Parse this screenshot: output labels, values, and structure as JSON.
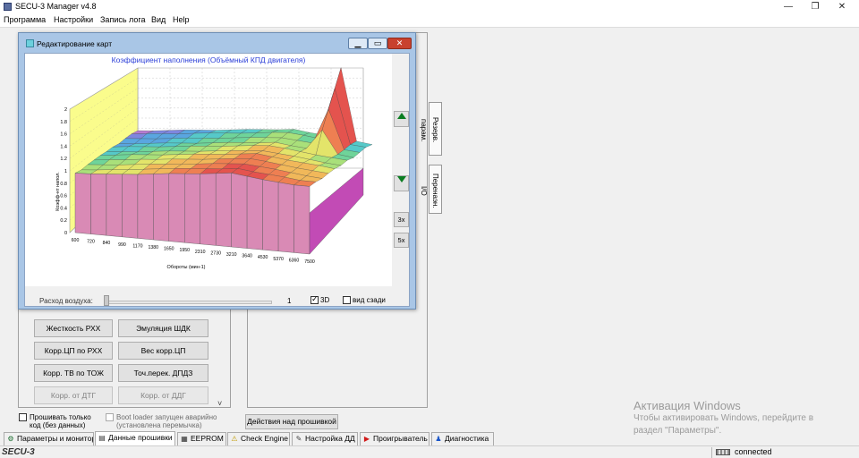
{
  "app": {
    "title": "SECU-3 Manager v4.8"
  },
  "window_controls": {
    "minimize": "—",
    "restore": "❐",
    "close": "✕"
  },
  "menu": [
    "Программа",
    "Настройки",
    "Запись лога",
    "Вид",
    "Help"
  ],
  "dialog": {
    "title": "Редактирование карт",
    "controls": {
      "minimize": "▁",
      "maximize": "▭",
      "close": "✕"
    },
    "side_buttons": {
      "zoom3": "3x",
      "zoom5": "5x"
    },
    "slider": {
      "label": "Расход воздуха:",
      "value": "1",
      "position": 0
    },
    "checkbox_3d": {
      "label": "3D",
      "checked": true
    },
    "checkbox_back": {
      "label": "вид сзади",
      "checked": false
    }
  },
  "chart_data": {
    "type": "surface3d",
    "title": "Коэффициент наполнения (Объёмный КПД двигателя)",
    "xlabel": "Обороты (мин-1)",
    "ylabel": "Коэфф-нт напол.",
    "zlim": [
      0,
      2
    ],
    "z_ticks": [
      "0",
      "0.2",
      "0.4",
      "0.6",
      "0.8",
      "1",
      "1.2",
      "1.4",
      "1.6",
      "1.8",
      "2"
    ],
    "x": [
      "600",
      "720",
      "840",
      "990",
      "1170",
      "1380",
      "1650",
      "1950",
      "2310",
      "2730",
      "3210",
      "3640",
      "4530",
      "5370",
      "6360",
      "7500"
    ],
    "rows_z": [
      [
        0.95,
        0.96,
        0.98,
        1.0,
        1.02,
        1.05,
        1.08,
        1.1,
        1.12,
        1.15,
        1.18,
        1.15,
        1.12,
        1.1,
        1.08,
        1.08
      ],
      [
        0.9,
        0.92,
        0.95,
        0.97,
        1.0,
        1.03,
        1.06,
        1.08,
        1.1,
        1.12,
        1.15,
        1.12,
        1.1,
        1.08,
        1.05,
        1.05
      ],
      [
        0.88,
        0.9,
        0.92,
        0.95,
        0.98,
        1.0,
        1.02,
        1.05,
        1.08,
        1.1,
        1.12,
        1.1,
        1.08,
        1.05,
        1.02,
        1.0
      ],
      [
        0.85,
        0.88,
        0.9,
        0.93,
        0.95,
        0.98,
        1.0,
        1.02,
        1.05,
        1.08,
        1.1,
        1.08,
        1.05,
        1.02,
        1.0,
        0.98
      ],
      [
        0.82,
        0.85,
        0.88,
        0.9,
        0.92,
        0.95,
        0.98,
        1.0,
        1.02,
        1.05,
        1.08,
        1.05,
        1.02,
        1.0,
        0.98,
        0.95
      ],
      [
        0.78,
        0.8,
        0.82,
        0.85,
        0.88,
        0.9,
        0.92,
        0.95,
        0.98,
        1.0,
        1.02,
        1.0,
        0.98,
        0.95,
        0.92,
        0.9
      ],
      [
        0.75,
        0.78,
        0.8,
        0.82,
        0.85,
        0.88,
        0.9,
        0.92,
        0.95,
        0.98,
        1.0,
        0.98,
        0.95,
        0.92,
        0.9,
        0.88
      ],
      [
        0.7,
        0.72,
        0.75,
        0.78,
        0.8,
        0.82,
        0.85,
        0.88,
        0.9,
        0.92,
        0.95,
        0.92,
        0.9,
        0.88,
        0.85,
        0.82
      ],
      [
        0.68,
        0.7,
        0.72,
        0.75,
        0.78,
        0.8,
        0.82,
        0.85,
        0.88,
        0.9,
        0.92,
        0.9,
        0.88,
        0.85,
        0.82,
        0.8
      ],
      [
        0.65,
        0.68,
        0.7,
        0.72,
        0.75,
        0.78,
        0.8,
        0.82,
        0.85,
        0.88,
        0.9,
        0.88,
        0.85,
        0.82,
        0.8,
        0.78
      ],
      [
        0.6,
        0.62,
        0.65,
        0.68,
        0.7,
        0.72,
        0.75,
        0.78,
        0.8,
        0.82,
        0.85,
        0.82,
        0.8,
        0.78,
        0.75,
        0.72
      ]
    ],
    "peak": {
      "x": "5370",
      "z": 1.9
    }
  },
  "vertical_tabs": [
    "Резерв. парам.",
    "Перенаэн. I/O"
  ],
  "left_buttons": [
    {
      "label": "Жесткость РХХ",
      "disabled": false
    },
    {
      "label": "Эмуляция ШДК",
      "disabled": false
    },
    {
      "label": "Корр.ЦП по РХХ",
      "disabled": false
    },
    {
      "label": "Вес корр.ЦП",
      "disabled": false
    },
    {
      "label": "Корр. ТВ по ТОЖ",
      "disabled": false
    },
    {
      "label": "Точ.перек. ДПДЗ",
      "disabled": false
    },
    {
      "label": "Корр. от ДТГ",
      "disabled": true
    },
    {
      "label": "Корр. от ДДГ",
      "disabled": true
    }
  ],
  "checkboxes": {
    "flash_code": "Прошивать только код (без данных)",
    "boot_loader": "Boot loader запущен аварийно (установлена перемычка)"
  },
  "firmware_action_button": "Действия над прошивкой",
  "scroll_arrow": "˅",
  "bottom_tabs": [
    {
      "label": "Параметры и монитор",
      "icon": "⚙",
      "color": "#1a6d2e"
    },
    {
      "label": "Данные прошивки",
      "icon": "▤",
      "color": "#333333"
    },
    {
      "label": "EEPROM",
      "icon": "▦",
      "color": "#2b2b2b"
    },
    {
      "label": "Check Engine",
      "icon": "⚠",
      "color": "#c19b00"
    },
    {
      "label": "Настройка ДД",
      "icon": "✎",
      "color": "#444444"
    },
    {
      "label": "Проигрыватель",
      "icon": "▶",
      "color": "#d11a1a"
    },
    {
      "label": "Диагностика",
      "icon": "♟",
      "color": "#1a55c8"
    }
  ],
  "status": {
    "logo": "SECU-3",
    "text": "connected"
  },
  "watermark": {
    "title": "Активация Windows",
    "line1": "Чтобы активировать Windows, перейдите в",
    "line2": "раздел \"Параметры\"."
  }
}
